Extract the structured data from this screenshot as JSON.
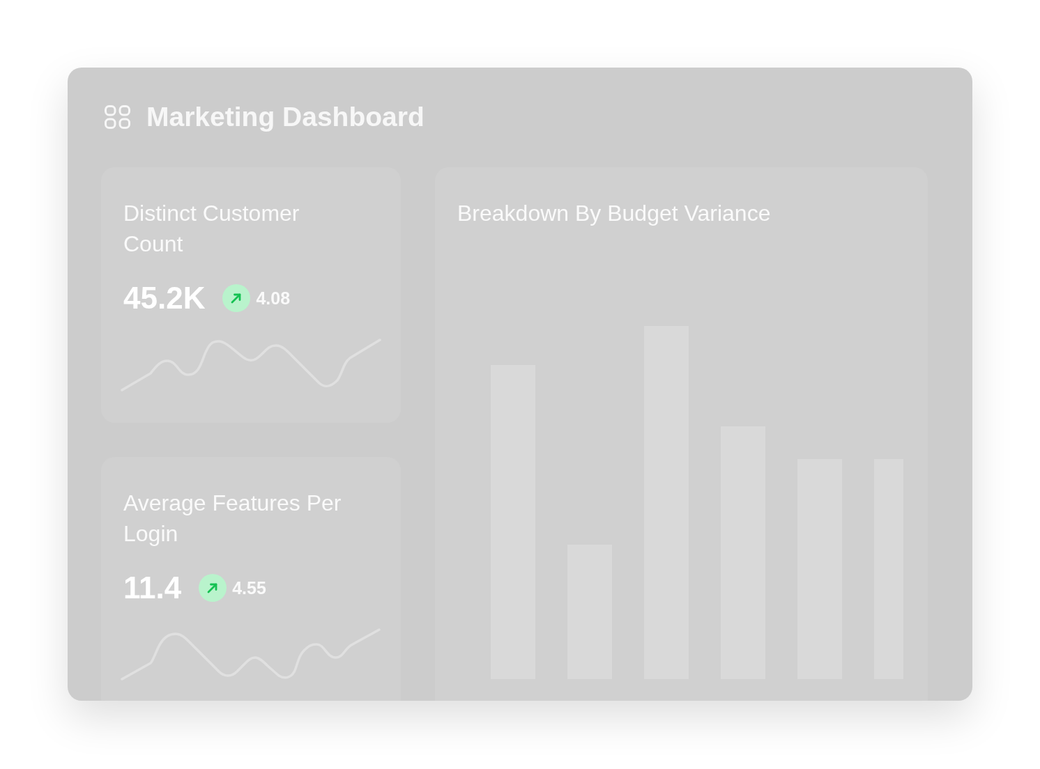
{
  "dashboard": {
    "title": "Marketing Dashboard"
  },
  "metrics": [
    {
      "title": "Distinct Customer Count",
      "value": "45.2K",
      "change": "4.08",
      "rising": true
    },
    {
      "title": "Average Features Per Login",
      "value": "11.4",
      "change": "4.55",
      "rising": true
    }
  ],
  "chart": {
    "title": "Breakdown By Budget Variance"
  }
}
